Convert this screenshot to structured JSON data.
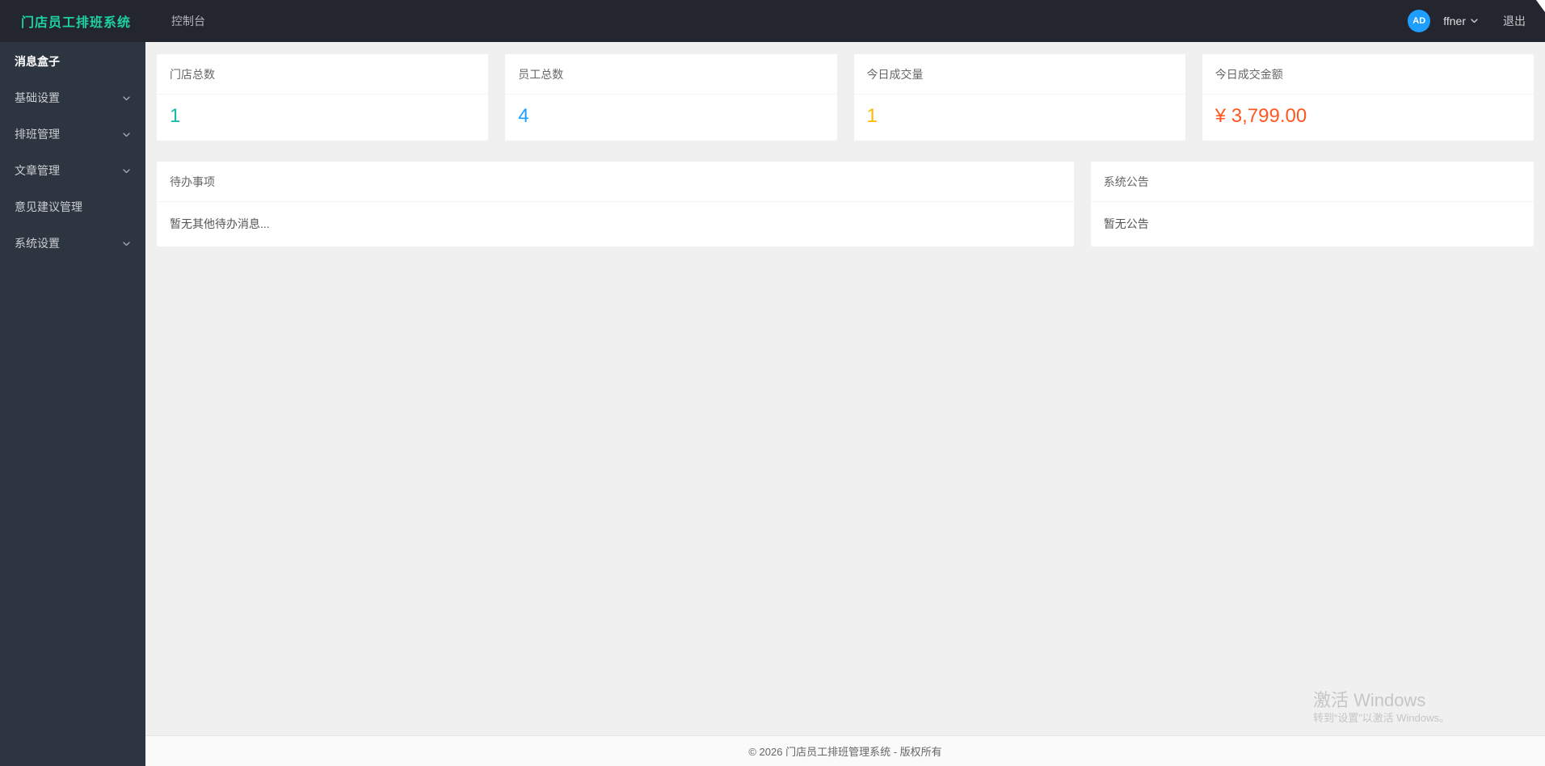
{
  "header": {
    "logo": "门店员工排班系统",
    "nav_console": "控制台",
    "user": {
      "initials": "AD",
      "name": "ffner",
      "logout_label": "退出"
    }
  },
  "sidebar": {
    "items": [
      {
        "label": "消息盒子",
        "has_children": false,
        "active": true
      },
      {
        "label": "基础设置",
        "has_children": true
      },
      {
        "label": "排班管理",
        "has_children": true
      },
      {
        "label": "文章管理",
        "has_children": true
      },
      {
        "label": "意见建议管理",
        "has_children": false
      },
      {
        "label": "系统设置",
        "has_children": true
      }
    ]
  },
  "stats": [
    {
      "label": "门店总数",
      "value": "1",
      "color": "#16baaa"
    },
    {
      "label": "员工总数",
      "value": "4",
      "color": "#1E9FFF"
    },
    {
      "label": "今日成交量",
      "value": "1",
      "color": "#FFB800"
    },
    {
      "label": "今日成交金额",
      "value": "¥ 3,799.00",
      "color": "#FF5722"
    }
  ],
  "panels": {
    "todo": {
      "title": "待办事项",
      "body": "暂无其他待办消息..."
    },
    "notice": {
      "title": "系统公告",
      "body": "暂无公告"
    }
  },
  "footer": {
    "text": "© 2026 门店员工排班管理系统 - 版权所有"
  },
  "watermark": {
    "line1": "激活 Windows",
    "line2": "转到“设置”以激活 Windows。"
  },
  "colors": {
    "topbar_bg": "#23262e",
    "sidebar_bg": "#2d3540",
    "logo_accent": "#1dd1a1",
    "avatar_bg": "#1E9FFF",
    "content_bg": "#f0f0f0"
  }
}
